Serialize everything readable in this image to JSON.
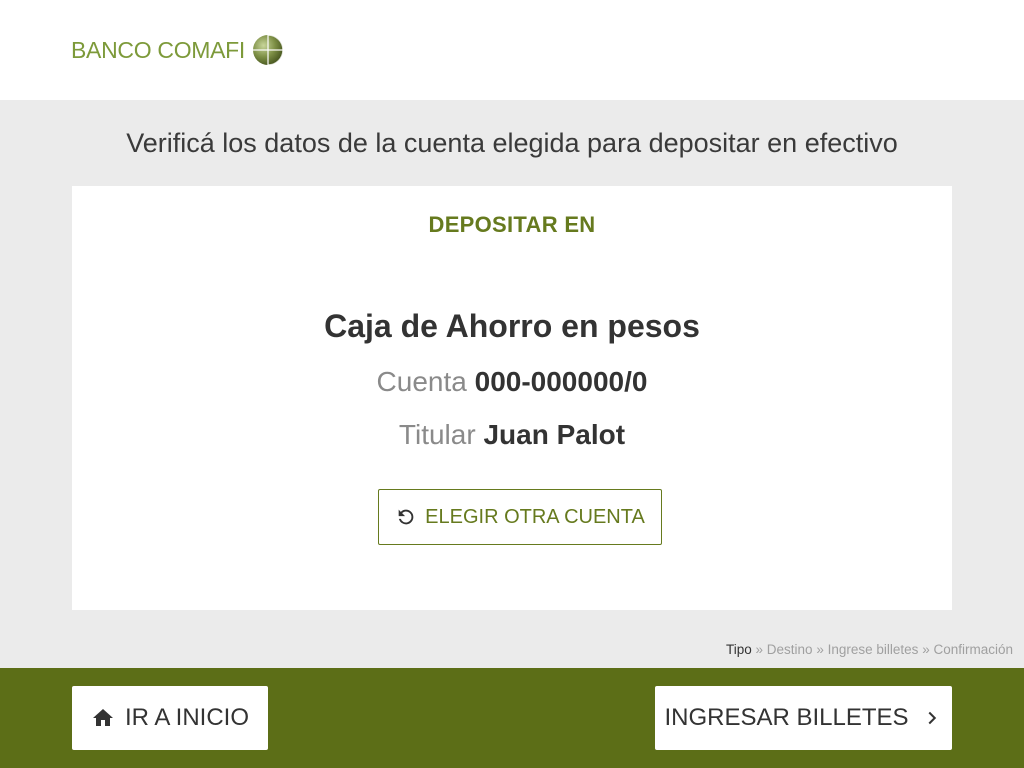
{
  "header": {
    "logo_text": "BANCO COMAFI"
  },
  "page_title": "Verificá los datos de la cuenta elegida para depositar en efectivo",
  "card": {
    "heading": "DEPOSITAR EN",
    "account_type": "Caja de Ahorro en pesos",
    "account_label": "Cuenta",
    "account_number": "000-000000/0",
    "holder_label": "Titular",
    "holder_name": "Juan Palot",
    "choose_other_label": "ELEGIR OTRA CUENTA"
  },
  "breadcrumb": {
    "steps": [
      "Tipo",
      "Destino",
      "Ingrese billetes",
      "Confirmación"
    ],
    "separator": "»"
  },
  "footer": {
    "home_label": "IR A INICIO",
    "next_label": "INGRESAR BILLETES"
  },
  "colors": {
    "brand_green": "#667a1e",
    "footer_green": "#5c6e17",
    "logo_green": "#7d9a3a"
  },
  "icons": {
    "choose_other": "refresh-icon",
    "home": "home-icon",
    "next": "chevron-right-icon"
  }
}
